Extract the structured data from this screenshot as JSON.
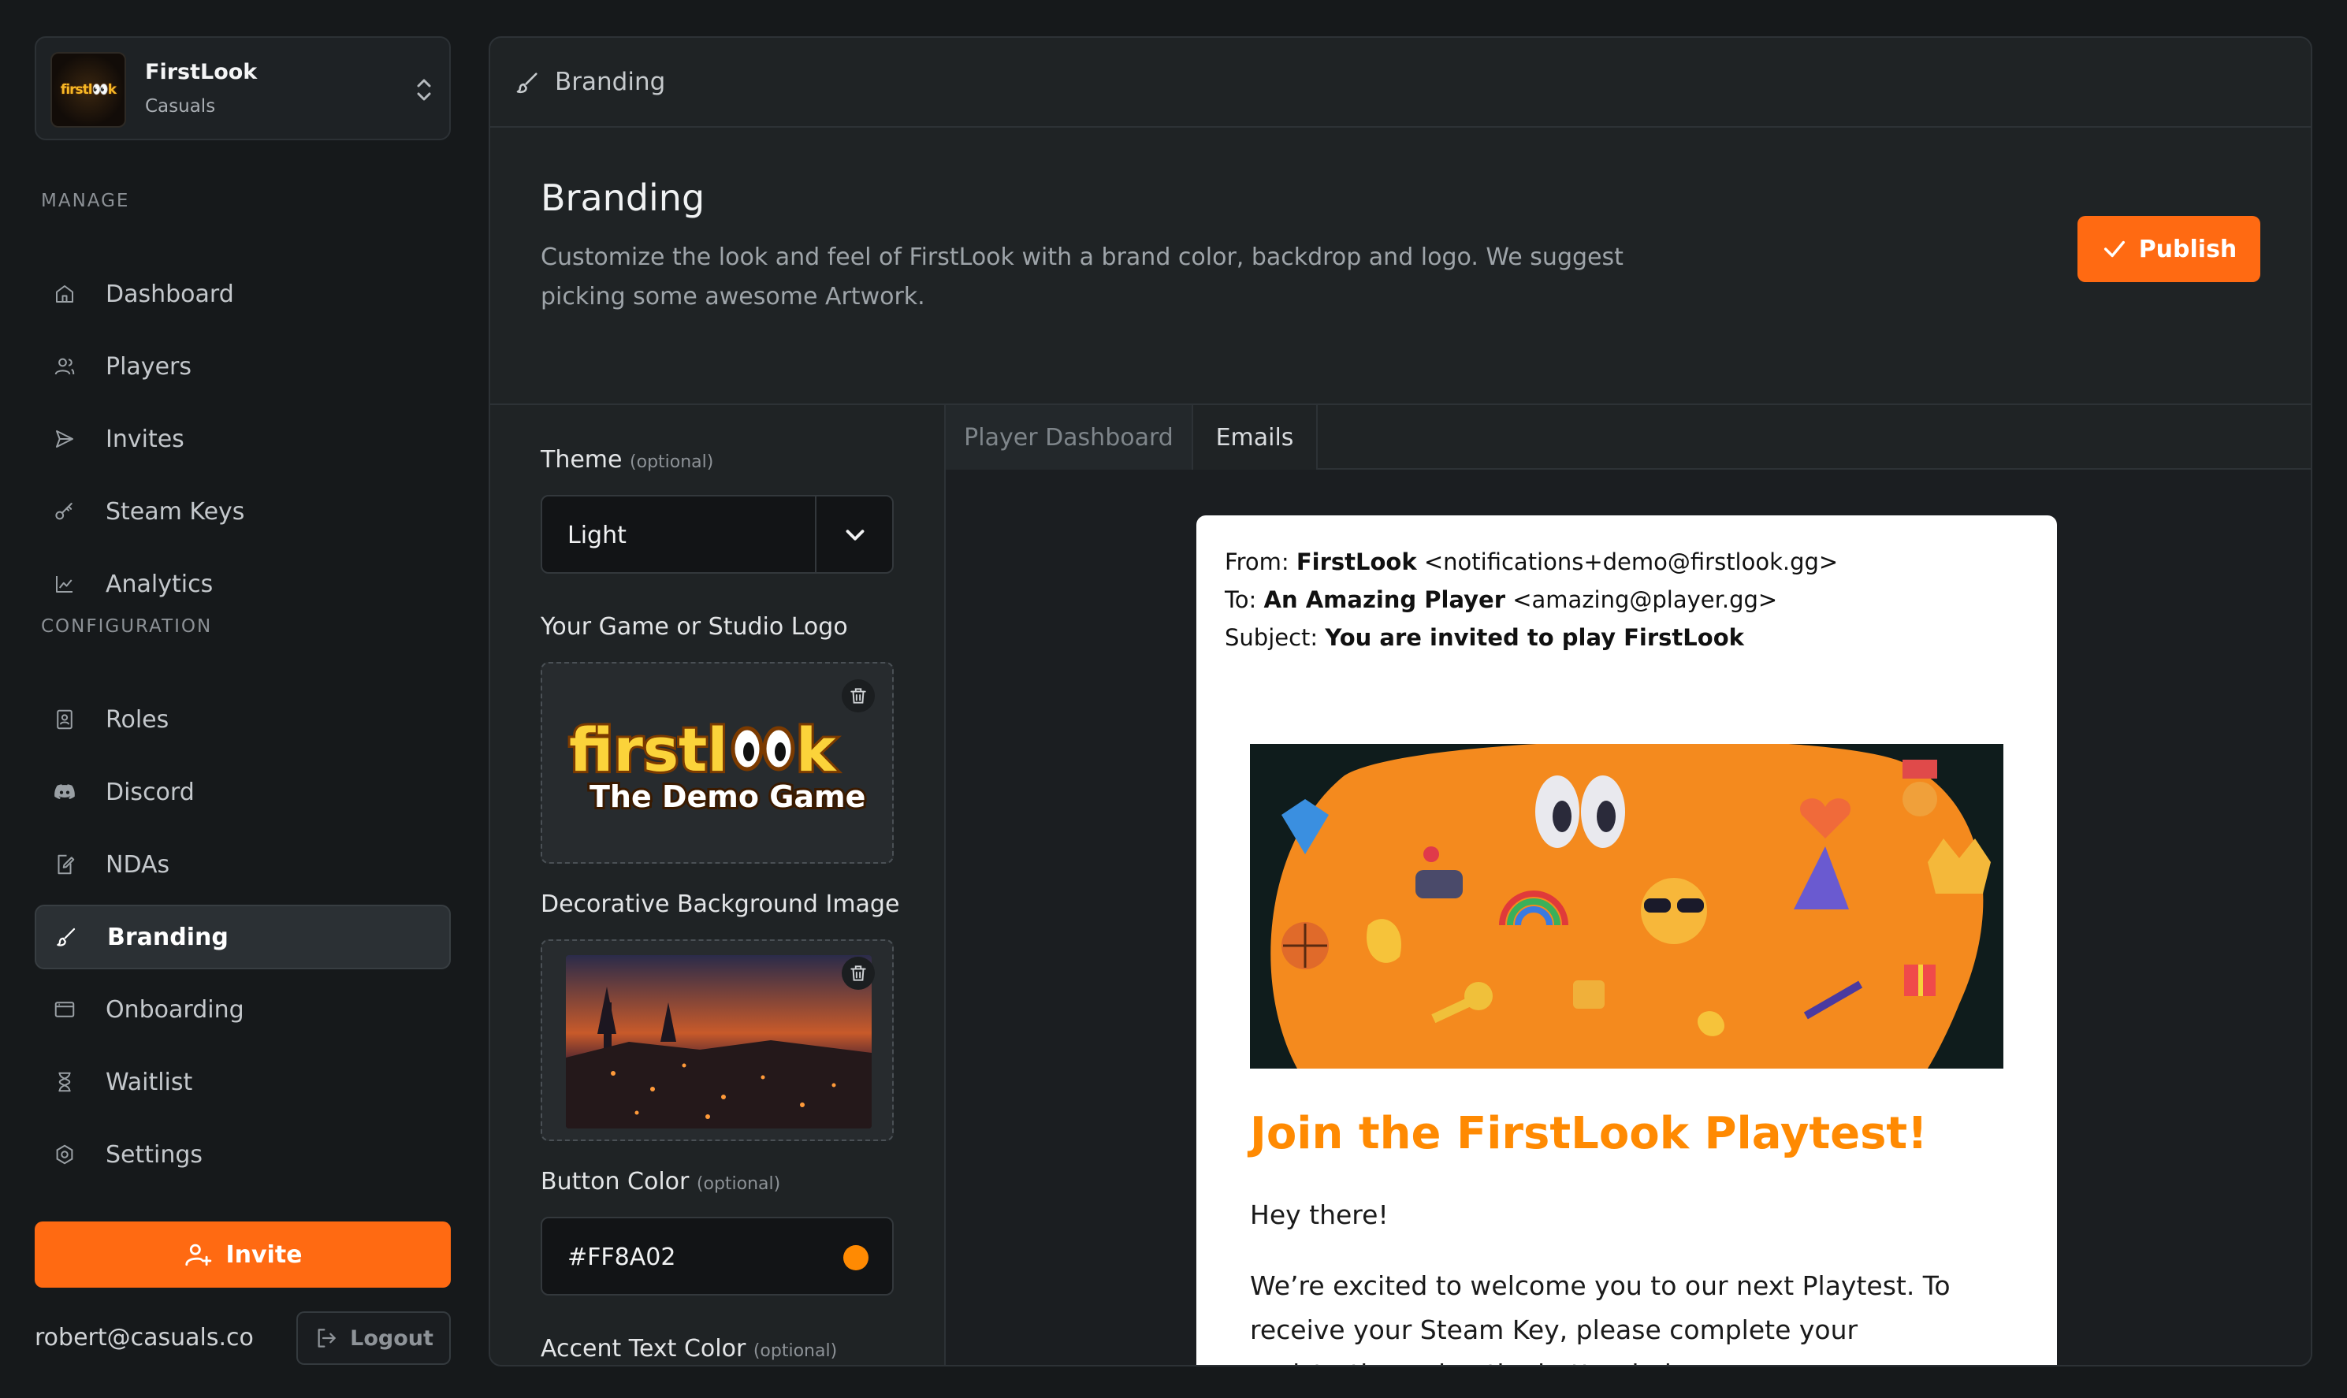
{
  "org": {
    "logo_text": "firstl👀k",
    "name": "FirstLook",
    "team": "Casuals"
  },
  "sidebar": {
    "manage_label": "MANAGE",
    "config_label": "CONFIGURATION",
    "items": [
      {
        "label": "Dashboard",
        "icon": "home-icon"
      },
      {
        "label": "Players",
        "icon": "users-icon"
      },
      {
        "label": "Invites",
        "icon": "send-icon"
      },
      {
        "label": "Steam Keys",
        "icon": "key-icon"
      },
      {
        "label": "Analytics",
        "icon": "chart-icon"
      },
      {
        "label": "Roles",
        "icon": "id-badge-icon"
      },
      {
        "label": "Discord",
        "icon": "discord-icon"
      },
      {
        "label": "NDAs",
        "icon": "document-edit-icon"
      },
      {
        "label": "Branding",
        "icon": "brush-icon",
        "active": true
      },
      {
        "label": "Onboarding",
        "icon": "window-icon"
      },
      {
        "label": "Waitlist",
        "icon": "hourglass-icon"
      },
      {
        "label": "Settings",
        "icon": "gear-icon"
      }
    ],
    "invite_label": "Invite",
    "user_email": "robert@casuals.co",
    "logout_label": "Logout"
  },
  "topbar": {
    "title": "Branding"
  },
  "page": {
    "title": "Branding",
    "description": "Customize the look and feel of FirstLook with a brand color, backdrop and logo. We suggest picking some awesome Artwork.",
    "publish_label": "Publish"
  },
  "form": {
    "theme_label": "Theme",
    "optional": "(optional)",
    "theme_value": "Light",
    "logo_label": "Your Game or Studio Logo",
    "logo_line1": "firstl",
    "logo_line1b": "k",
    "logo_line2": "The Demo Game",
    "bg_label": "Decorative Background Image",
    "button_color_label": "Button Color",
    "button_color_value": "#FF8A02",
    "accent_label": "Accent Text Color"
  },
  "preview": {
    "tabs": [
      "Player Dashboard",
      "Emails"
    ],
    "active_tab": "Emails",
    "from_prefix": "From:",
    "from_name": "FirstLook",
    "from_addr": "<notifications+demo@firstlook.gg>",
    "to_prefix": "To:",
    "to_name": "An Amazing Player",
    "to_addr": "<amazing@player.gg>",
    "subject_prefix": "Subject:",
    "subject": "You are invited to play FirstLook",
    "title": "Join the FirstLook Playtest!",
    "greeting": "Hey there!",
    "body": "We’re excited to welcome you to our next Playtest. To receive your Steam Key, please complete your registration using the button below."
  },
  "colors": {
    "accent": "#ff6a12",
    "brand": "#FF8A02",
    "background": "#16191b",
    "panel": "#1f2325"
  }
}
